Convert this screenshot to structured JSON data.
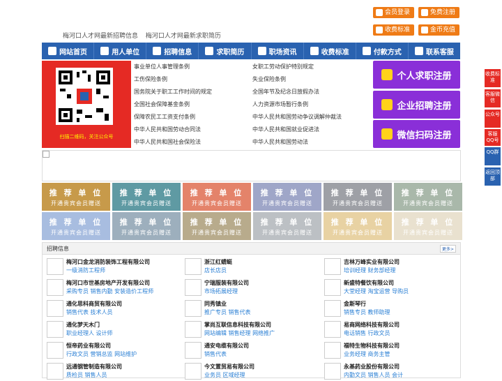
{
  "top_buttons": [
    {
      "label": "会员登录",
      "icon": "user-icon"
    },
    {
      "label": "免费注册",
      "icon": "person-add-icon"
    },
    {
      "label": "收费标准",
      "icon": "yen-icon"
    },
    {
      "label": "金币充值",
      "icon": "coin-icon"
    }
  ],
  "top_links": [
    "梅河口人才网最新招聘信息",
    "梅河口人才网最新求职简历"
  ],
  "nav": [
    {
      "label": "网站首页",
      "icon": "home-icon"
    },
    {
      "label": "用人单位",
      "icon": "building-icon"
    },
    {
      "label": "招聘信息",
      "icon": "megaphone-icon"
    },
    {
      "label": "求职简历",
      "icon": "search-icon"
    },
    {
      "label": "职场资讯",
      "icon": "news-icon"
    },
    {
      "label": "收费标准",
      "icon": "yen-icon"
    },
    {
      "label": "付款方式",
      "icon": "payment-icon"
    },
    {
      "label": "联系客服",
      "icon": "phone-icon"
    }
  ],
  "qr_caption": "扫描二维码，关注公众号",
  "links_left": [
    "事业单位人事管理条例",
    "工伤保险条例",
    "国务院关于职工工作时间的规定",
    "全国社会保障基金条例",
    "保障农民工工资支付条例",
    "中华人民共和国劳动合同法",
    "中华人民共和国社会保险法"
  ],
  "links_right": [
    "女职工劳动保护特别规定",
    "失业保险条例",
    "全国年节及纪念日放假办法",
    "人力资源市场暂行条例",
    "中华人民共和国劳动争议调解仲裁法",
    "中华人民共和国就业促进法",
    "中华人民共和国劳动法"
  ],
  "register": [
    {
      "label": "个人求职注册",
      "icon": "person-icon"
    },
    {
      "label": "企业招聘注册",
      "icon": "enterprise-icon"
    },
    {
      "label": "微信扫码注册",
      "icon": "wechat-icon"
    }
  ],
  "tile_title": "推 荐 单 位",
  "tile_sub": "开通贵宾会员赠送",
  "tile_colors": [
    "#c79a4a",
    "#5f9aa3",
    "#e4836a",
    "#9fa6c8",
    "#9ea0a6",
    "#a9b8aa",
    "#a8bde0",
    "#9dafbd",
    "#b8ab8c",
    "#bcc0c4",
    "#e8d2a3",
    "#e9e1cf"
  ],
  "panel": {
    "title": "招聘信息",
    "more": "更多>"
  },
  "companies": [
    [
      {
        "name": "梅河口金龙消防装饰工程有限公司",
        "jobs": "一级消防工程师"
      },
      {
        "name": "浙江红蜻蜓",
        "jobs": "店长店员"
      },
      {
        "name": "吉林万峰实业有限公司",
        "jobs": "培训经理 财务部经理"
      }
    ],
    [
      {
        "name": "梅河口市世基房地产开发有限公司",
        "jobs": "采购专员 销售内勤 安装造价工程师"
      },
      {
        "name": "宁瑞服装有限公司",
        "jobs": "市场拓展经理"
      },
      {
        "name": "新盛特餐饮有限公司",
        "jobs": "大堂经理 淘宝运营 导购员"
      }
    ],
    [
      {
        "name": "通化思科商贸有限公司",
        "jobs": "销售代表 技术人员"
      },
      {
        "name": "同秀镇业",
        "jobs": "推广专员 销售代表"
      },
      {
        "name": "金斯琴行",
        "jobs": "销售专员 教师助理"
      }
    ],
    [
      {
        "name": "通化梦天木门",
        "jobs": "职业经理人 设计师"
      },
      {
        "name": "掌尚互联信息科技有限公司",
        "jobs": "网站编辑 销售经理 网络推广"
      },
      {
        "name": "易商网络科技有限公司",
        "jobs": "电话销售 行政文员"
      }
    ],
    [
      {
        "name": "恒帝药业有限公司",
        "jobs": "行政文员 营销总监 网站维护"
      },
      {
        "name": "通安电缆有限公司",
        "jobs": "销售代表"
      },
      {
        "name": "福特生物科技有限公司",
        "jobs": "业务经理 商务主管"
      }
    ],
    [
      {
        "name": "远通钢管制造有限公司",
        "jobs": "质检员 销售人员"
      },
      {
        "name": "今文置贸易有限公司",
        "jobs": "业务员 区域经理"
      },
      {
        "name": "永基药业股份有限公司",
        "jobs": "内勤文员 销售人员 会计"
      }
    ]
  ],
  "sidebar": [
    "收费标准",
    "客服微信",
    "公众号",
    "客服QQ号",
    "QQ群",
    "返回顶部"
  ]
}
